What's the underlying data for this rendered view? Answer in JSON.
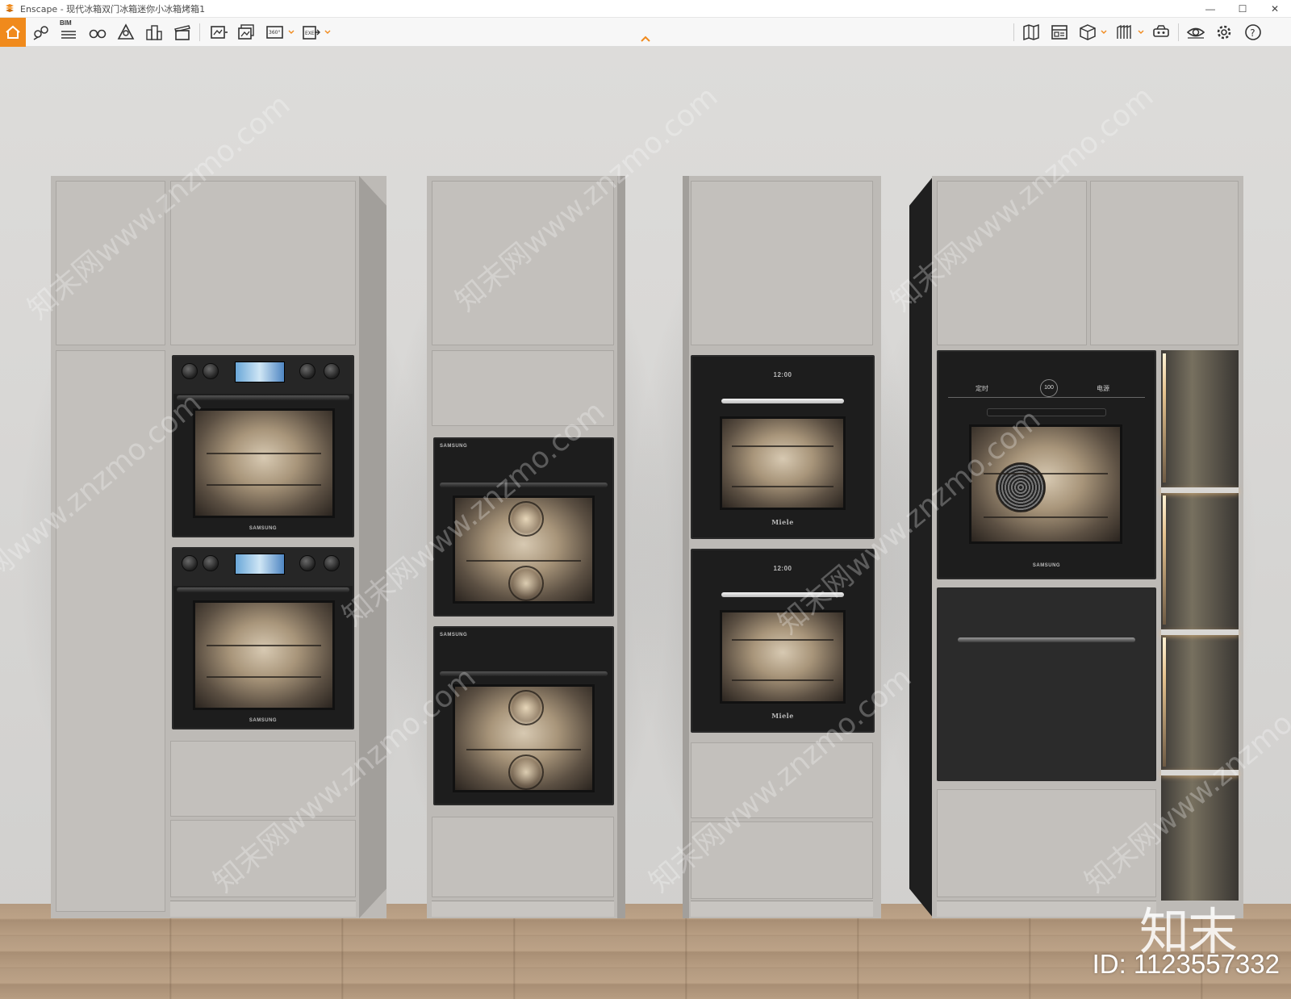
{
  "window": {
    "title": "Enscape - 现代冰箱双门冰箱迷你小冰箱烤箱1",
    "minimize_glyph": "—",
    "maximize_glyph": "☐",
    "close_glyph": "✕"
  },
  "toolbar": {
    "accent_color": "#f08a1c",
    "bim_label": "BIM",
    "left_icons": [
      "home-icon",
      "views-icon",
      "bim-icon",
      "binoculars-icon",
      "outline-icon",
      "buildings-icon",
      "clapperboard-icon"
    ],
    "export_icons": [
      "render-screenshot-icon",
      "render-batch-icon",
      "panorama-360-icon",
      "export-exe-icon"
    ],
    "pano_label": "360°",
    "exe_label": "EXE",
    "right_icons": [
      "map-icon",
      "asset-library-icon",
      "cube-icon",
      "material-editor-icon",
      "vr-headset-icon",
      "visual-settings-icon",
      "settings-icon",
      "help-icon"
    ],
    "help_label": "?"
  },
  "scene": {
    "watermark_text": "知末网www.znzmo.com",
    "logo_text": "知末",
    "image_id": "ID: 1123557332",
    "brands": {
      "samsung": "SAMSUNG",
      "miele": "Miele"
    },
    "clock_display": "12:00",
    "oven_labels": {
      "timer": "定时",
      "power": "电源",
      "display": "100"
    }
  }
}
